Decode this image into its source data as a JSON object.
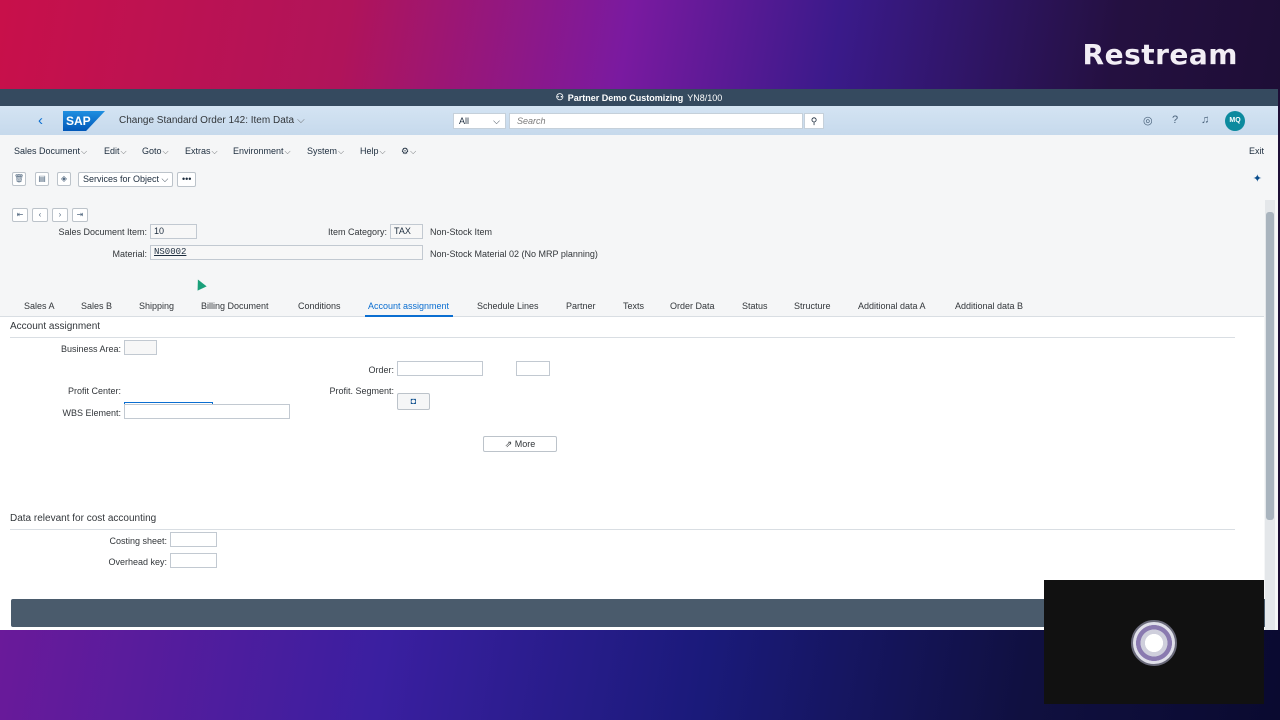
{
  "brand": "Restream",
  "titlebar": {
    "text": "Partner Demo Customizing",
    "system": "YN8/100"
  },
  "shell": {
    "logo": "SAP",
    "title": "Change Standard Order 142: Item Data",
    "scope": "All",
    "search_placeholder": "Search",
    "avatar": "MQ"
  },
  "menu": {
    "items": [
      "Sales Document",
      "Edit",
      "Goto",
      "Extras",
      "Environment",
      "System",
      "Help"
    ],
    "exit": "Exit"
  },
  "toolbar": {
    "services": "Services for Object",
    "more": "•••"
  },
  "header": {
    "item_label": "Sales Document Item:",
    "item_value": "10",
    "category_label": "Item Category:",
    "category_value": "TAX",
    "category_text": "Non-Stock Item",
    "material_label": "Material:",
    "material_value": "NS0002",
    "material_text": "Non-Stock Material 02 (No MRP planning)"
  },
  "tabs": [
    "Sales A",
    "Sales B",
    "Shipping",
    "Billing Document",
    "Conditions",
    "Account assignment",
    "Schedule Lines",
    "Partner",
    "Texts",
    "Order Data",
    "Status",
    "Structure",
    "Additional data A",
    "Additional data B"
  ],
  "active_tab": "Account assignment",
  "account_assignment": {
    "title": "Account assignment",
    "business_area_label": "Business Area:",
    "order_label": "Order:",
    "profit_center_label": "Profit Center:",
    "profit_segment_label": "Profit. Segment:",
    "wbs_label": "WBS Element:",
    "more_button": "More"
  },
  "cost_accounting": {
    "title": "Data relevant for cost accounting",
    "costing_sheet_label": "Costing sheet:",
    "overhead_key_label": "Overhead key:"
  },
  "colors": {
    "shell": "#d4e4f3",
    "accent": "#0a6ed1",
    "titlebar": "#354a5f"
  }
}
